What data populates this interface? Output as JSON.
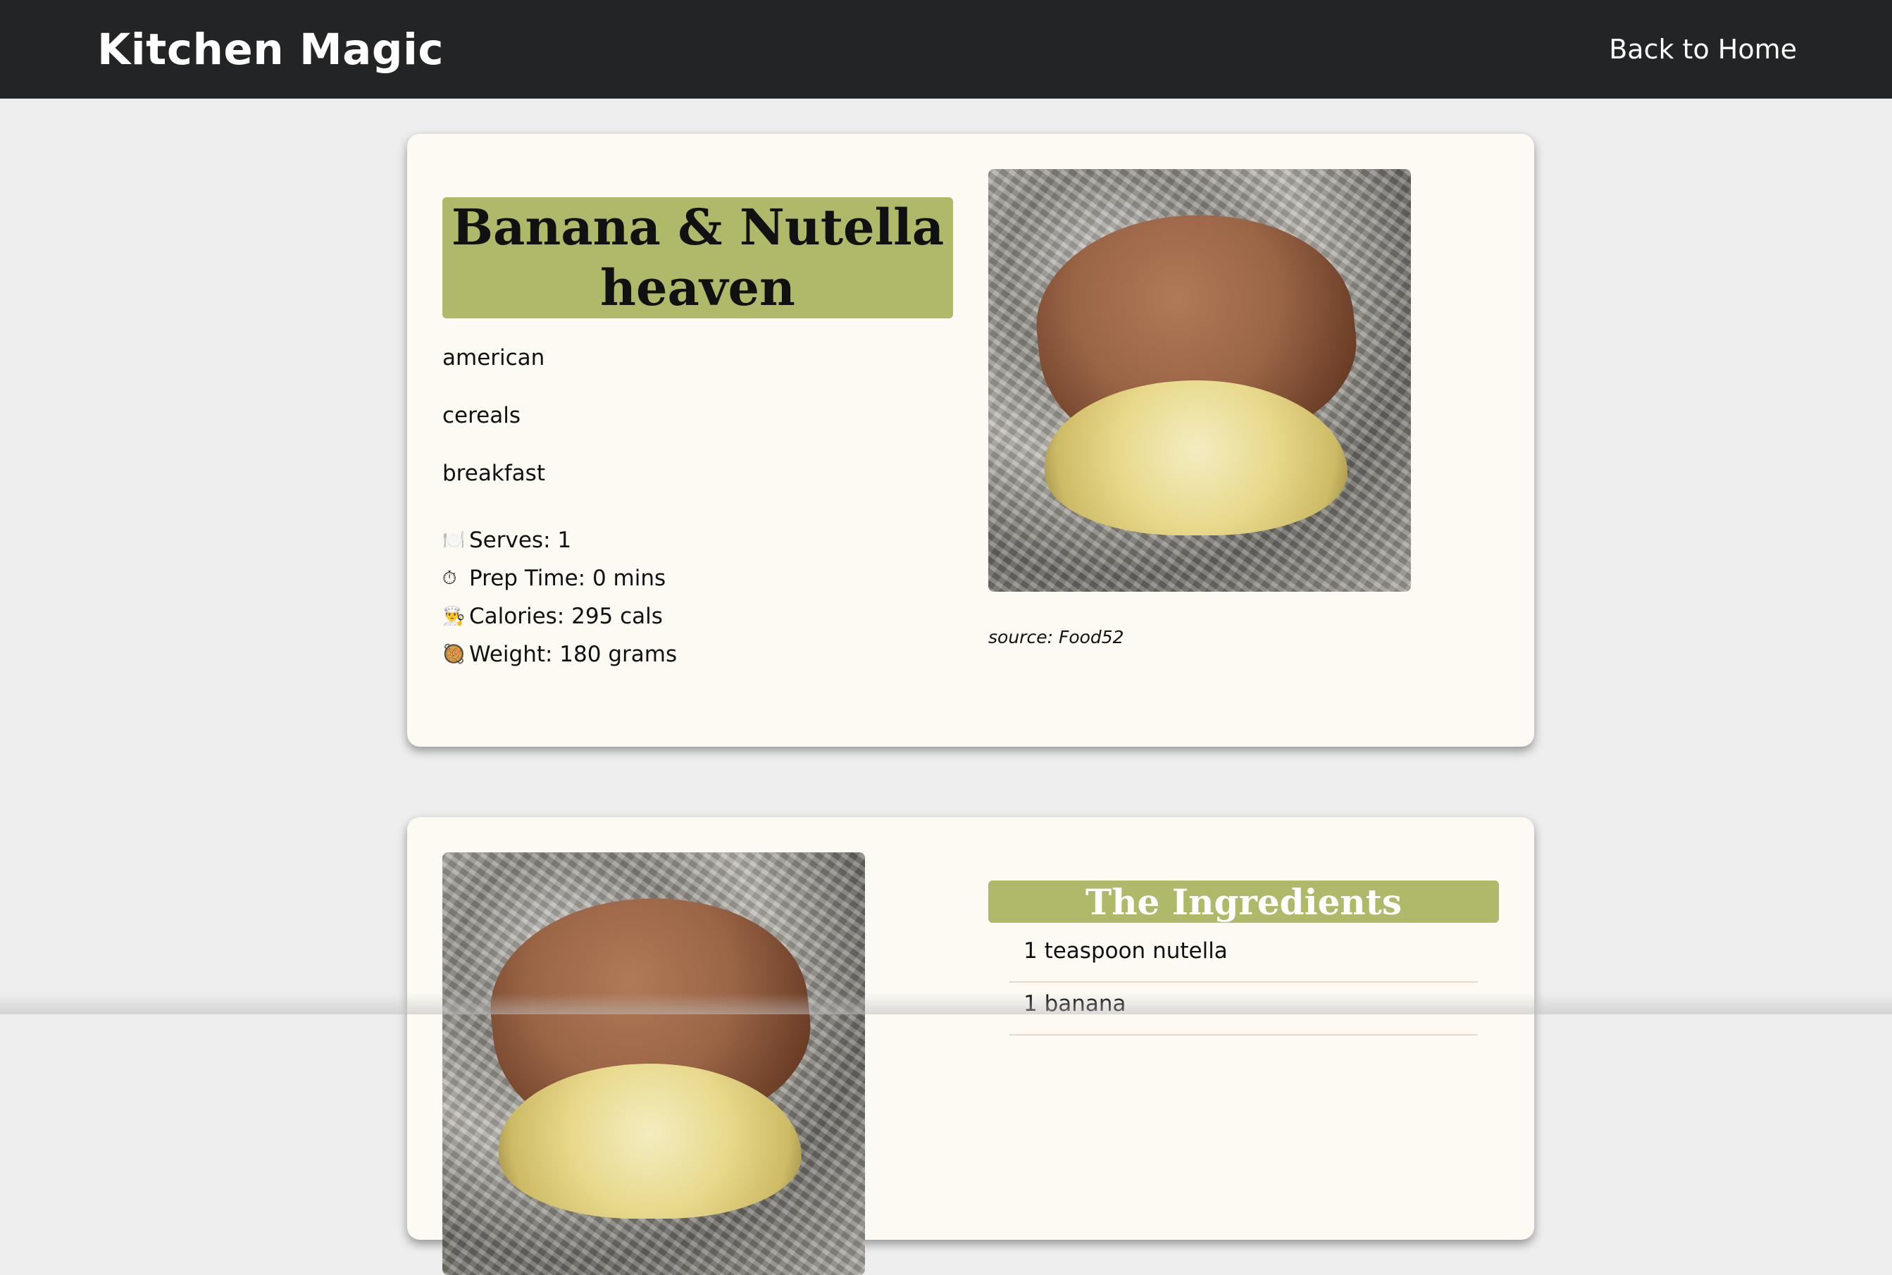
{
  "header": {
    "brand": "Kitchen Magic",
    "home_link": "Back to Home",
    "background_color": "#232425"
  },
  "recipe": {
    "title": "Banana & Nutella heaven",
    "tags": [
      "american",
      "cereals",
      "breakfast"
    ],
    "stats": [
      {
        "icon": "plate-cutlery-icon",
        "glyph": "🍽️",
        "text": "Serves: 1"
      },
      {
        "icon": "stopwatch-icon",
        "glyph": "⏱",
        "text": "Prep Time: 0 mins"
      },
      {
        "icon": "chef-icon",
        "glyph": "👨‍🍳",
        "text": "Calories: 295 cals"
      },
      {
        "icon": "bowl-icon",
        "glyph": "🥘",
        "text": "Weight: 180 grams"
      }
    ],
    "source": "source: Food52",
    "accent_color": "#b0b96a"
  },
  "ingredients": {
    "heading": "The Ingredients",
    "items": [
      "1 teaspoon nutella",
      "1 banana"
    ]
  }
}
